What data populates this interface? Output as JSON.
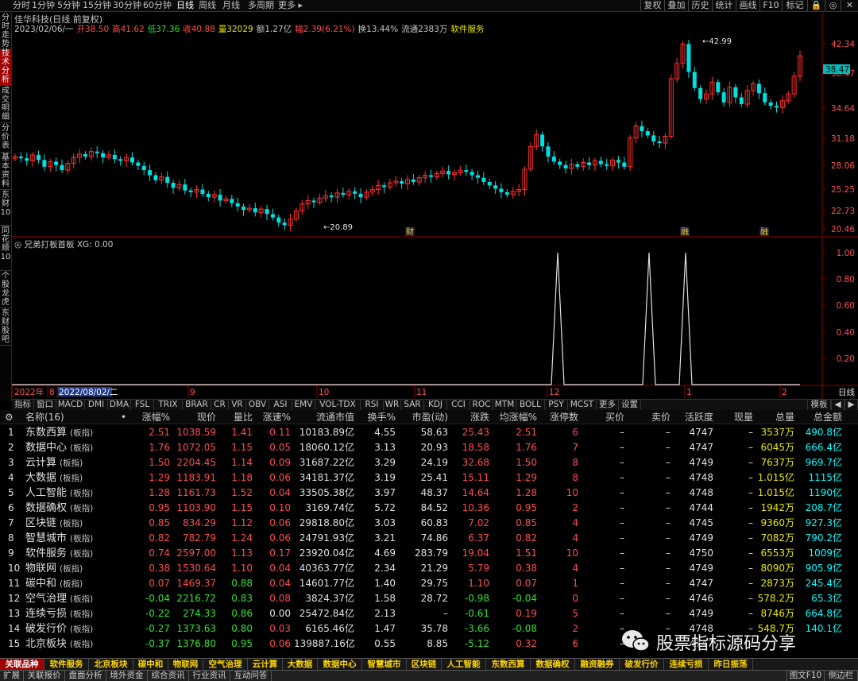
{
  "periods": [
    "分时",
    "1分钟",
    "5分钟",
    "15分钟",
    "30分钟",
    "60分钟",
    "日线",
    "周线",
    "月线",
    "多周期",
    "更多 ▸"
  ],
  "active_period": "日线",
  "toolbar_buttons": [
    "复权",
    "叠加",
    "历史",
    "统计",
    "画线",
    "F10",
    "标记",
    "🔒",
    "◎",
    "✕"
  ],
  "left_tabs": [
    {
      "label": "分时走势",
      "active": false
    },
    {
      "label": "技术分析",
      "active": true
    },
    {
      "label": "成交明细",
      "active": false
    },
    {
      "label": "分价表",
      "active": false
    },
    {
      "label": "基本资料",
      "active": false
    },
    {
      "label": "东财10",
      "active": false
    },
    {
      "label": "同花顺10",
      "active": false
    },
    {
      "label": "个股龙虎",
      "active": false
    },
    {
      "label": "东财股吧",
      "active": false
    }
  ],
  "quote": {
    "title": "佳华科技(日线 前复权)",
    "line": [
      {
        "text": "2023/02/06/一",
        "color": "#c8c8c8"
      },
      {
        "text": "开38.50",
        "color": "#ff4d4d"
      },
      {
        "text": "高41.62",
        "color": "#ff4d4d"
      },
      {
        "text": "低37.36",
        "color": "#33e033"
      },
      {
        "text": "收40.88",
        "color": "#ff4d4d"
      },
      {
        "text": "量32029",
        "color": "#e8e800"
      },
      {
        "text": "额1.27亿",
        "color": "#c8c8c8"
      },
      {
        "text": "幅2.39(6.21%)",
        "color": "#ff4d4d"
      },
      {
        "text": "换13.44%",
        "color": "#c8c8c8"
      },
      {
        "text": "流通2383万",
        "color": "#c8c8c8"
      },
      {
        "text": "软件服务",
        "color": "#e8e800"
      }
    ]
  },
  "price_axis": [
    "42.34",
    "38.47",
    "34.64",
    "31.18",
    "28.06",
    "25.25",
    "22.73",
    "20.46"
  ],
  "current_price": "38.47",
  "high_label": "42.99",
  "low_label": "20.89",
  "event_markers": [
    "财",
    "融",
    "融"
  ],
  "indicator": {
    "title": "兄弟打板首板",
    "value_text": "XG: 0.00",
    "axis": [
      "1.00",
      "0.80",
      "0.60",
      "0.40",
      "0.20"
    ]
  },
  "date_axis": [
    "2022年",
    "8",
    "2022/08/02/二",
    "9",
    "10",
    "11",
    "12",
    "1",
    "2"
  ],
  "date_axis_label": "日线",
  "indicator_tabs": [
    "指标",
    "窗口",
    "MACD",
    "DMI",
    "DMA",
    "FSL",
    "TRIX",
    "BRAR",
    "CR",
    "VR",
    "OBV",
    "ASI",
    "EMV",
    "VOL-TDX",
    "RSI",
    "WR",
    "SAR",
    "KDJ",
    "CCI",
    "ROC",
    "MTM",
    "BOLL",
    "PSY",
    "MCST",
    "更多",
    "设置"
  ],
  "indicator_tabs_right": [
    "模板",
    "◀",
    "▶"
  ],
  "table": {
    "headers": [
      "⚙",
      "名称(16)",
      "•",
      "涨幅%",
      "现价",
      "量比",
      "涨速%",
      "流通市值",
      "换手%",
      "市盈(动)",
      "涨跌",
      "均涨幅%",
      "涨停数",
      "买价",
      "卖价",
      "活跃度",
      "现量",
      "总量",
      "总金额"
    ],
    "rows": [
      {
        "no": "1",
        "name": "东数西算",
        "tag": "(板指)",
        "chg": "2.51",
        "price": "1038.59",
        "vr": "1.41",
        "spd": "0.11",
        "cap": "10183.89亿",
        "turn": "4.55",
        "pe": "58.63",
        "diff": "25.43",
        "avg": "2.51",
        "limit": "6",
        "bid": "–",
        "ask": "–",
        "act": "4747",
        "cur": "–",
        "vol": "3537万",
        "amt": "490.8亿",
        "dir": "up",
        "spd_dir": "up"
      },
      {
        "no": "2",
        "name": "数据中心",
        "tag": "(板指)",
        "chg": "1.76",
        "price": "1072.05",
        "vr": "1.15",
        "spd": "0.05",
        "cap": "18060.12亿",
        "turn": "3.13",
        "pe": "20.93",
        "diff": "18.58",
        "avg": "1.76",
        "limit": "7",
        "bid": "–",
        "ask": "–",
        "act": "4747",
        "cur": "–",
        "vol": "6045万",
        "amt": "666.4亿",
        "dir": "up",
        "spd_dir": "up"
      },
      {
        "no": "3",
        "name": "云计算",
        "tag": "(板指)",
        "chg": "1.50",
        "price": "2204.45",
        "vr": "1.14",
        "spd": "0.09",
        "cap": "31687.22亿",
        "turn": "3.29",
        "pe": "24.19",
        "diff": "32.68",
        "avg": "1.50",
        "limit": "8",
        "bid": "–",
        "ask": "–",
        "act": "4749",
        "cur": "–",
        "vol": "7637万",
        "amt": "969.7亿",
        "dir": "up",
        "spd_dir": "up"
      },
      {
        "no": "4",
        "name": "大数据",
        "tag": "(板指)",
        "chg": "1.29",
        "price": "1183.91",
        "vr": "1.18",
        "spd": "0.06",
        "cap": "34181.37亿",
        "turn": "3.19",
        "pe": "25.41",
        "diff": "15.11",
        "avg": "1.29",
        "limit": "8",
        "bid": "–",
        "ask": "–",
        "act": "4748",
        "cur": "–",
        "vol": "1.015亿",
        "amt": "1115亿",
        "dir": "up",
        "spd_dir": "up"
      },
      {
        "no": "5",
        "name": "人工智能",
        "tag": "(板指)",
        "chg": "1.28",
        "price": "1161.73",
        "vr": "1.52",
        "spd": "0.04",
        "cap": "33505.38亿",
        "turn": "3.97",
        "pe": "48.37",
        "diff": "14.64",
        "avg": "1.28",
        "limit": "10",
        "bid": "–",
        "ask": "–",
        "act": "4748",
        "cur": "–",
        "vol": "1.015亿",
        "amt": "1190亿",
        "dir": "up",
        "spd_dir": "up"
      },
      {
        "no": "6",
        "name": "数据确权",
        "tag": "(板指)",
        "chg": "0.95",
        "price": "1103.90",
        "vr": "1.15",
        "spd": "0.10",
        "cap": "3169.74亿",
        "turn": "5.72",
        "pe": "84.52",
        "diff": "10.36",
        "avg": "0.95",
        "limit": "2",
        "bid": "–",
        "ask": "–",
        "act": "4744",
        "cur": "–",
        "vol": "1942万",
        "amt": "208.7亿",
        "dir": "up",
        "spd_dir": "up"
      },
      {
        "no": "7",
        "name": "区块链",
        "tag": "(板指)",
        "chg": "0.85",
        "price": "834.29",
        "vr": "1.12",
        "spd": "0.06",
        "cap": "29818.80亿",
        "turn": "3.03",
        "pe": "60.83",
        "diff": "7.02",
        "avg": "0.85",
        "limit": "4",
        "bid": "–",
        "ask": "–",
        "act": "4745",
        "cur": "–",
        "vol": "9360万",
        "amt": "927.3亿",
        "dir": "up",
        "spd_dir": "up"
      },
      {
        "no": "8",
        "name": "智慧城市",
        "tag": "(板指)",
        "chg": "0.82",
        "price": "782.79",
        "vr": "1.24",
        "spd": "0.06",
        "cap": "24791.93亿",
        "turn": "3.21",
        "pe": "74.86",
        "diff": "6.37",
        "avg": "0.82",
        "limit": "4",
        "bid": "–",
        "ask": "–",
        "act": "4749",
        "cur": "–",
        "vol": "7082万",
        "amt": "790.2亿",
        "dir": "up",
        "spd_dir": "up"
      },
      {
        "no": "9",
        "name": "软件服务",
        "tag": "(板指)",
        "chg": "0.74",
        "price": "2597.00",
        "vr": "1.13",
        "spd": "0.17",
        "cap": "23920.04亿",
        "turn": "4.69",
        "pe": "283.79",
        "diff": "19.04",
        "avg": "1.51",
        "limit": "10",
        "bid": "–",
        "ask": "–",
        "act": "4750",
        "cur": "–",
        "vol": "6553万",
        "amt": "1009亿",
        "dir": "up",
        "spd_dir": "up"
      },
      {
        "no": "10",
        "name": "物联网",
        "tag": "(板指)",
        "chg": "0.38",
        "price": "1530.64",
        "vr": "1.10",
        "spd": "0.04",
        "cap": "40363.77亿",
        "turn": "2.34",
        "pe": "21.29",
        "diff": "5.79",
        "avg": "0.38",
        "limit": "4",
        "bid": "–",
        "ask": "–",
        "act": "4749",
        "cur": "–",
        "vol": "8090万",
        "amt": "905.9亿",
        "dir": "up",
        "spd_dir": "up"
      },
      {
        "no": "11",
        "name": "碳中和",
        "tag": "(板指)",
        "chg": "0.07",
        "price": "1469.37",
        "vr": "0.88",
        "spd": "0.04",
        "cap": "14601.77亿",
        "turn": "1.40",
        "pe": "29.75",
        "diff": "1.10",
        "avg": "0.07",
        "limit": "1",
        "bid": "–",
        "ask": "–",
        "act": "4747",
        "cur": "–",
        "vol": "2873万",
        "amt": "245.4亿",
        "dir": "up",
        "spd_dir": "up"
      },
      {
        "no": "12",
        "name": "空气治理",
        "tag": "(板指)",
        "chg": "-0.04",
        "price": "2216.72",
        "vr": "0.83",
        "spd": "0.08",
        "cap": "3824.37亿",
        "turn": "1.58",
        "pe": "28.72",
        "diff": "-0.98",
        "avg": "-0.04",
        "limit": "0",
        "bid": "–",
        "ask": "–",
        "act": "4746",
        "cur": "–",
        "vol": "578.2万",
        "amt": "65.3亿",
        "dir": "down",
        "spd_dir": "up"
      },
      {
        "no": "13",
        "name": "连续亏损",
        "tag": "(板指)",
        "chg": "-0.22",
        "price": "274.33",
        "vr": "0.86",
        "spd": "0.00",
        "cap": "25472.84亿",
        "turn": "2.13",
        "pe": "–",
        "diff": "-0.61",
        "avg": "0.19",
        "limit": "5",
        "bid": "–",
        "ask": "–",
        "act": "4749",
        "cur": "–",
        "vol": "8746万",
        "amt": "664.8亿",
        "dir": "down",
        "spd_dir": "flat"
      },
      {
        "no": "14",
        "name": "破发行价",
        "tag": "(板指)",
        "chg": "-0.27",
        "price": "1373.63",
        "vr": "0.80",
        "spd": "0.03",
        "cap": "6165.46亿",
        "turn": "1.47",
        "pe": "35.78",
        "diff": "-3.66",
        "avg": "-0.08",
        "limit": "2",
        "bid": "–",
        "ask": "–",
        "act": "4748",
        "cur": "–",
        "vol": "548.7万",
        "amt": "140.1亿",
        "dir": "down",
        "spd_dir": "up"
      },
      {
        "no": "15",
        "name": "北京板块",
        "tag": "(板指)",
        "chg": "-0.37",
        "price": "1376.80",
        "vr": "0.95",
        "spd": "0.06",
        "cap": "139887.16亿",
        "turn": "0.55",
        "pe": "8.85",
        "diff": "-5.12",
        "avg": "0.32",
        "limit": "6",
        "bid": "–",
        "ask": "–",
        "act": "4747",
        "cur": "–",
        "vol": "",
        "amt": "",
        "dir": "down",
        "spd_dir": "up"
      }
    ]
  },
  "block_tabs": [
    "关联品种",
    "软件服务",
    "北京板块",
    "碳中和",
    "物联网",
    "空气治理",
    "云计算",
    "大数据",
    "数据中心",
    "智慧城市",
    "区块链",
    "人工智能",
    "东数西算",
    "数据确权",
    "融资融券",
    "破发行价",
    "连续亏损",
    "昨日振荡"
  ],
  "status_tabs": [
    "扩展",
    "关联报价",
    "盘面分析",
    "境外资金",
    "综合资讯",
    "行业资讯",
    "互动问答"
  ],
  "status_right": [
    "图文F10",
    "侧边栏"
  ],
  "watermark": "股票指标源码分享",
  "colors": {
    "up": "#ff4d4d",
    "down": "#33e033",
    "accent": "#a00000",
    "cyan": "#00ffff",
    "yellow": "#e8e800"
  }
}
